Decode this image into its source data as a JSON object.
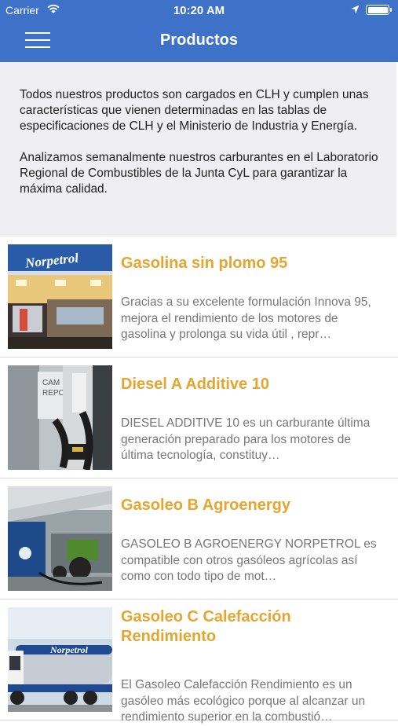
{
  "status": {
    "carrier": "Carrier",
    "time": "10:20 AM"
  },
  "header": {
    "title": "Productos"
  },
  "intro": {
    "p1": "Todos nuestros productos son cargados en CLH y cumplen unas características que vienen determinadas en las tablas de especificaciones de CLH y el Ministerio de Industria y Energía.",
    "p2": "Analizamos semanalmente nuestros carburantes en el Laboratorio Regional de Combustibles de la Junta CyL para garantizar la máxima calidad."
  },
  "products": [
    {
      "title": "Gasolina sin plomo 95",
      "description": "Gracias a su excelente formulación Innova 95, mejora el rendimiento de los motores de gasolina y prolonga su vida útil , repr…",
      "brand": "Norpetrol"
    },
    {
      "title": "Diesel A Additive 10",
      "description": "DIESEL ADDITIVE 10 es un carburante última generación preparado para los motores de última tecnología, constituy…",
      "sign": "CAM\nREPC"
    },
    {
      "title": "Gasoleo B Agroenergy",
      "description": "GASOLEO B AGROENERGY NORPETROL es compatible con otros gasóleos agrícolas así como con todo tipo de mot…"
    },
    {
      "title": "Gasoleo C Calefacción Rendimiento",
      "description": "El Gasoleo Calefacción Rendimiento es un gasóleo más ecológico porque al alcanzar un rendimiento superior en la combustió…",
      "brand": "Norpetrol"
    }
  ],
  "colors": {
    "nav": "#3d72c8",
    "accent": "#e6a52f",
    "intro_bg": "#eeeef3"
  }
}
